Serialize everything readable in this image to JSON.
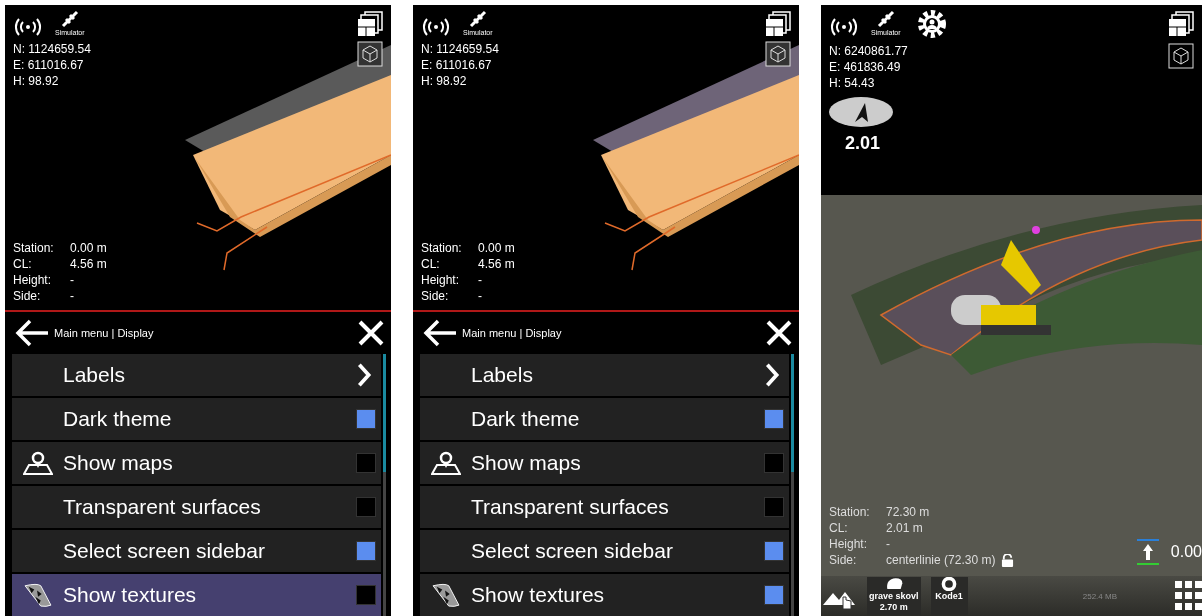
{
  "screens": [
    {
      "kind": "menu",
      "status": {
        "gps_label": "Simulator"
      },
      "coords": [
        "N: 1124659.54",
        "E: 611016.67",
        "H: 98.92"
      ],
      "readouts": [
        {
          "label": "Station:",
          "value": "0.00 m"
        },
        {
          "label": "CL:",
          "value": "4.56 m"
        },
        {
          "label": "Height:",
          "value": "-"
        },
        {
          "label": "Side:",
          "value": "-"
        }
      ],
      "menu": {
        "breadcrumb": "Main menu | Display",
        "items": [
          {
            "label": "Labels",
            "kind": "submenu",
            "selected": false
          },
          {
            "label": "Dark theme",
            "kind": "toggle",
            "checked": true,
            "selected": false
          },
          {
            "label": "Show maps",
            "kind": "maptoggle",
            "checked": false,
            "selected": false
          },
          {
            "label": "Transparent surfaces",
            "kind": "toggle",
            "checked": false,
            "selected": false
          },
          {
            "label": "Select screen sidebar",
            "kind": "toggle",
            "checked": true,
            "selected": false
          },
          {
            "label": "Show textures",
            "kind": "texturetoggle",
            "checked": false,
            "selected": true
          }
        ]
      }
    },
    {
      "kind": "menu",
      "status": {
        "gps_label": "Simulator"
      },
      "coords": [
        "N: 1124659.54",
        "E: 611016.67",
        "H: 98.92"
      ],
      "readouts": [
        {
          "label": "Station:",
          "value": "0.00 m"
        },
        {
          "label": "CL:",
          "value": "4.56 m"
        },
        {
          "label": "Height:",
          "value": "-"
        },
        {
          "label": "Side:",
          "value": "-"
        }
      ],
      "menu": {
        "breadcrumb": "Main menu | Display",
        "items": [
          {
            "label": "Labels",
            "kind": "submenu",
            "selected": false
          },
          {
            "label": "Dark theme",
            "kind": "toggle",
            "checked": true,
            "selected": false
          },
          {
            "label": "Show maps",
            "kind": "maptoggle",
            "checked": false,
            "selected": false
          },
          {
            "label": "Transparent surfaces",
            "kind": "toggle",
            "checked": false,
            "selected": false
          },
          {
            "label": "Select screen sidebar",
            "kind": "toggle",
            "checked": true,
            "selected": false
          },
          {
            "label": "Show textures",
            "kind": "texturetoggle",
            "checked": true,
            "selected": false
          }
        ]
      }
    },
    {
      "kind": "map",
      "status": {
        "gps_label": "Simulator"
      },
      "coords": [
        "N: 6240861.77",
        "E: 461836.49",
        "H: 54.43"
      ],
      "heading": "2.01",
      "readouts": [
        {
          "label": "Station:",
          "value": "72.30 m"
        },
        {
          "label": "CL:",
          "value": "2.01 m"
        },
        {
          "label": "Height:",
          "value": "-"
        },
        {
          "label": "Side:",
          "value": "centerlinie (72.30 m)",
          "locked": false
        }
      ],
      "elevation": "0.00",
      "toolbar": [
        {
          "kind": "terrain"
        },
        {
          "kind": "bucket",
          "lines": [
            "grave skovl",
            "2.70 m"
          ]
        },
        {
          "kind": "code",
          "lines": [
            "Kode1"
          ]
        }
      ],
      "memory": "252.4 MB"
    }
  ]
}
